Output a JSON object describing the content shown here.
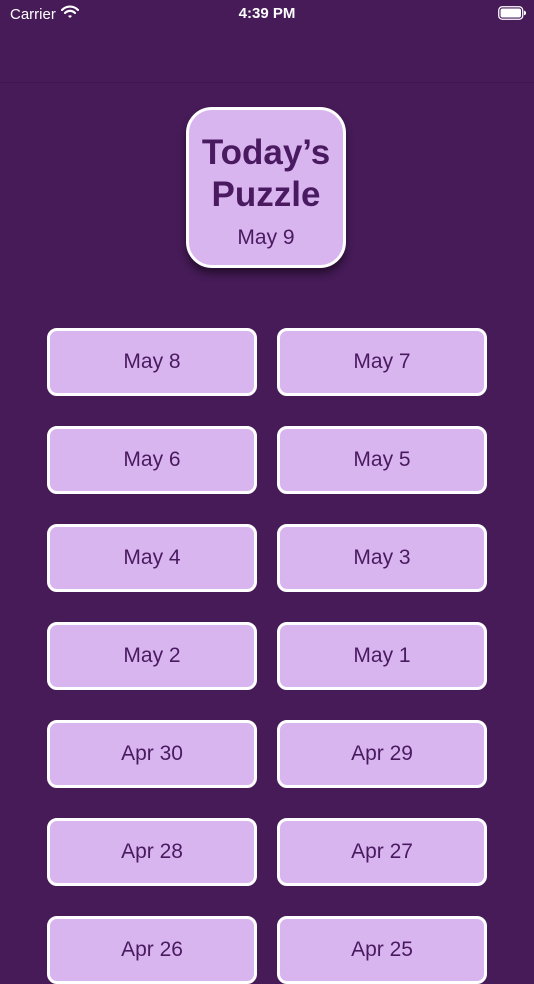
{
  "status_bar": {
    "carrier": "Carrier",
    "time": "4:39 PM"
  },
  "today": {
    "title": "Today’s Puzzle",
    "date": "May 9"
  },
  "puzzles": [
    "May 8",
    "May 7",
    "May 6",
    "May 5",
    "May 4",
    "May 3",
    "May 2",
    "May 1",
    "Apr 30",
    "Apr 29",
    "Apr 28",
    "Apr 27",
    "Apr 26",
    "Apr 25"
  ],
  "colors": {
    "background": "#461b58",
    "button_fill": "#d9b5ef",
    "button_text": "#4a1a60",
    "button_border": "#ffffff"
  },
  "icons": [
    "wifi-icon",
    "battery-icon"
  ]
}
